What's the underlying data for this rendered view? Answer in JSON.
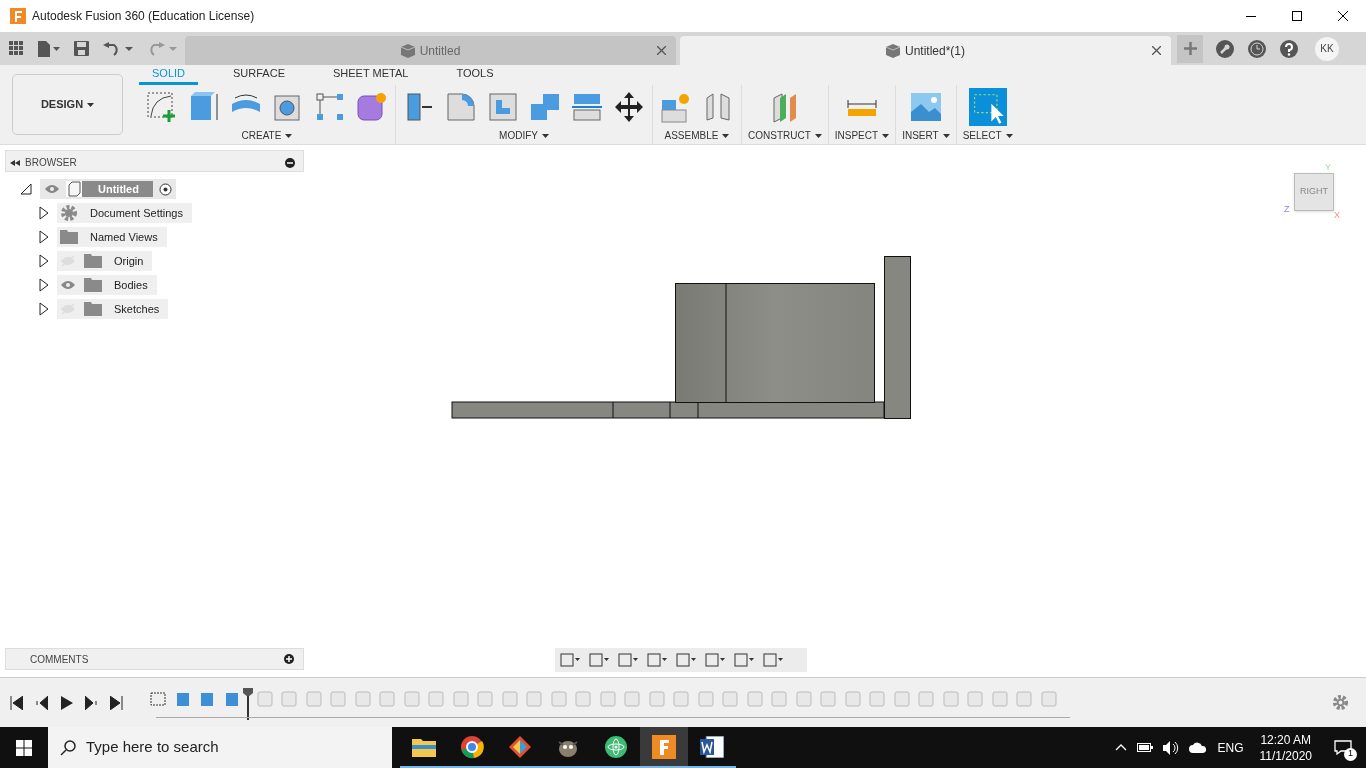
{
  "window": {
    "title": "Autodesk Fusion 360 (Education License)"
  },
  "doc_tabs": [
    {
      "label": "Untitled",
      "selected": false
    },
    {
      "label": "Untitled*(1)",
      "selected": true
    }
  ],
  "user": {
    "initials": "KK"
  },
  "workspace": {
    "label": "DESIGN"
  },
  "ribbon_tabs": [
    {
      "label": "SOLID",
      "selected": true
    },
    {
      "label": "SURFACE",
      "selected": false
    },
    {
      "label": "SHEET METAL",
      "selected": false
    },
    {
      "label": "TOOLS",
      "selected": false
    }
  ],
  "ribbon_groups": [
    {
      "label": "CREATE"
    },
    {
      "label": "MODIFY"
    },
    {
      "label": "ASSEMBLE"
    },
    {
      "label": "CONSTRUCT"
    },
    {
      "label": "INSPECT"
    },
    {
      "label": "INSERT"
    },
    {
      "label": "SELECT"
    }
  ],
  "browser": {
    "title": "BROWSER",
    "root": {
      "label": "Untitled",
      "expanded": true,
      "visible": true,
      "children": [
        {
          "label": "Document Settings",
          "expanded": false
        },
        {
          "label": "Named Views",
          "expanded": false
        },
        {
          "label": "Origin",
          "visible": false,
          "expanded": false
        },
        {
          "label": "Bodies",
          "visible": true,
          "expanded": false
        },
        {
          "label": "Sketches",
          "visible": false,
          "expanded": false
        }
      ]
    }
  },
  "comments": {
    "title": "COMMENTS"
  },
  "viewcube": {
    "face": "RIGHT",
    "axes": [
      "Y",
      "Z",
      "X"
    ]
  },
  "taskbar": {
    "search_placeholder": "Type here to search",
    "apps": [
      {
        "kind": "explorer",
        "selected": false
      },
      {
        "kind": "chrome",
        "selected": false
      },
      {
        "kind": "git",
        "selected": false
      },
      {
        "kind": "gimp",
        "selected": false
      },
      {
        "kind": "atom",
        "selected": false
      },
      {
        "kind": "fusion",
        "selected": true
      },
      {
        "kind": "word",
        "selected": false
      }
    ],
    "language": "ENG",
    "time": "12:20 AM",
    "date": "11/1/2020",
    "notifications": "1"
  }
}
